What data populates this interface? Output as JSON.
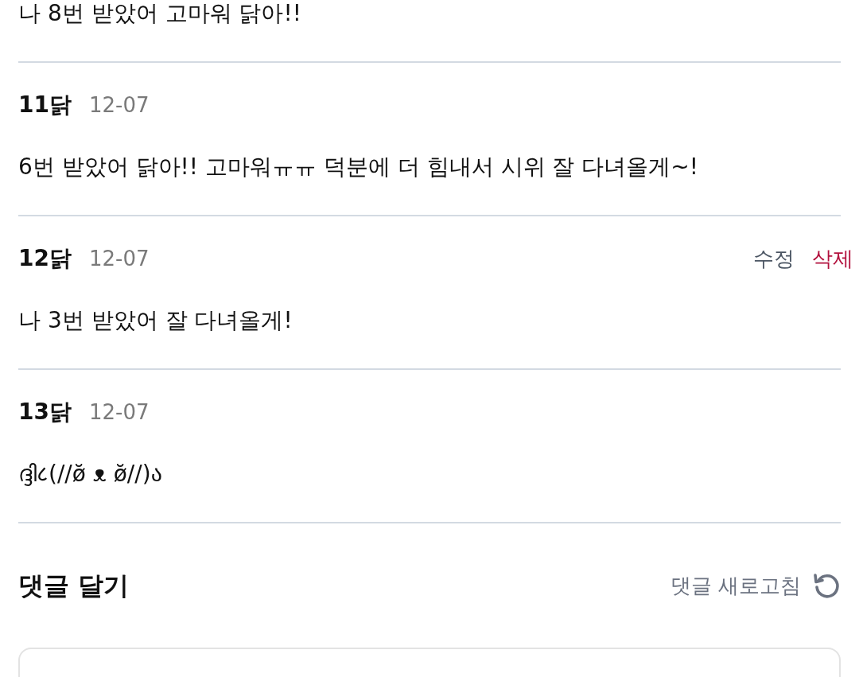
{
  "partial_comment": {
    "body": "나 8번 받았어 고마워 닭아!!"
  },
  "comments": [
    {
      "author": "11닭",
      "date": "12-07",
      "body": "6번 받았어 닭아!! 고마워ㅠㅠ 덕분에 더 힘내서 시위 잘 다녀올게~!"
    },
    {
      "author": "12닭",
      "date": "12-07",
      "actions": [
        {
          "kind": "edit",
          "label": "수정"
        },
        {
          "kind": "delete",
          "label": "삭제"
        }
      ],
      "body": "나 3번 받았어 잘 다녀올게!"
    },
    {
      "author": "13닭",
      "date": "12-07",
      "body": "ദ്ദി८(//ø̆ ᴥ ø̆//)ა"
    }
  ],
  "comment_form": {
    "title": "댓글 달기",
    "refresh_label": "댓글 새로고침"
  }
}
